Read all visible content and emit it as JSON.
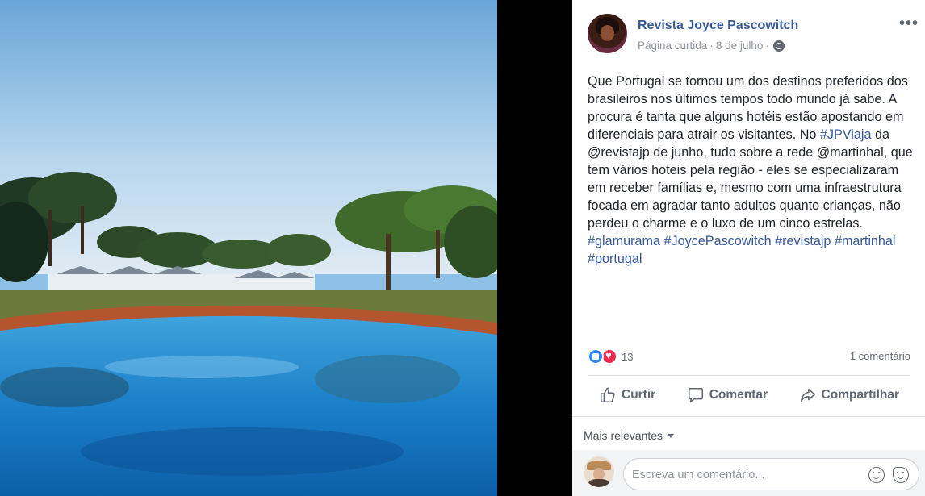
{
  "post": {
    "page_name": "Revista Joyce Pascowitch",
    "page_type": "Página curtida",
    "separator": "·",
    "date": "8 de julho",
    "text_segments": [
      {
        "text": "Que Portugal se tornou um dos destinos preferidos dos brasileiros nos últimos tempos todo mundo já sabe. A procura é tanta que alguns hotéis estão apostando em diferenciais para atrair os visitantes. No ",
        "hashtag": false
      },
      {
        "text": "#JPViaja",
        "hashtag": true
      },
      {
        "text": " da @revistajp de junho, tudo sobre a rede @martinhal, que tem vários hoteis pela região - eles se especializaram em receber famílias e, mesmo com uma infraestrutura focada em agradar tanto adultos quanto crianças, não perdeu o charme e o luxo de um cinco estrelas. ",
        "hashtag": false
      },
      {
        "text": "#glamurama",
        "hashtag": true
      },
      {
        "text": " ",
        "hashtag": false
      },
      {
        "text": "#JoycePascowitch",
        "hashtag": true
      },
      {
        "text": " ",
        "hashtag": false
      },
      {
        "text": "#revistajp",
        "hashtag": true
      },
      {
        "text": " ",
        "hashtag": false
      },
      {
        "text": "#martinhal",
        "hashtag": true
      },
      {
        "text": " ",
        "hashtag": false
      },
      {
        "text": "#portugal",
        "hashtag": true
      }
    ],
    "reaction_count": "13",
    "comment_count": "1 comentário"
  },
  "actions": {
    "like": "Curtir",
    "comment": "Comentar",
    "share": "Compartilhar"
  },
  "comments": {
    "sort_label": "Mais relevantes",
    "input_placeholder": "Escreva um comentário..."
  },
  "icons": [
    "more-options-icon",
    "globe-icon",
    "like-reaction-icon",
    "love-reaction-icon",
    "thumbs-up-icon",
    "comment-bubble-icon",
    "share-arrow-icon",
    "caret-down-icon",
    "emoji-icon",
    "sticker-icon"
  ],
  "colors": {
    "link": "#365899",
    "text": "#1d2129",
    "muted": "#90949c",
    "like_blue": "#2d88ff",
    "love_red": "#f0284a"
  }
}
